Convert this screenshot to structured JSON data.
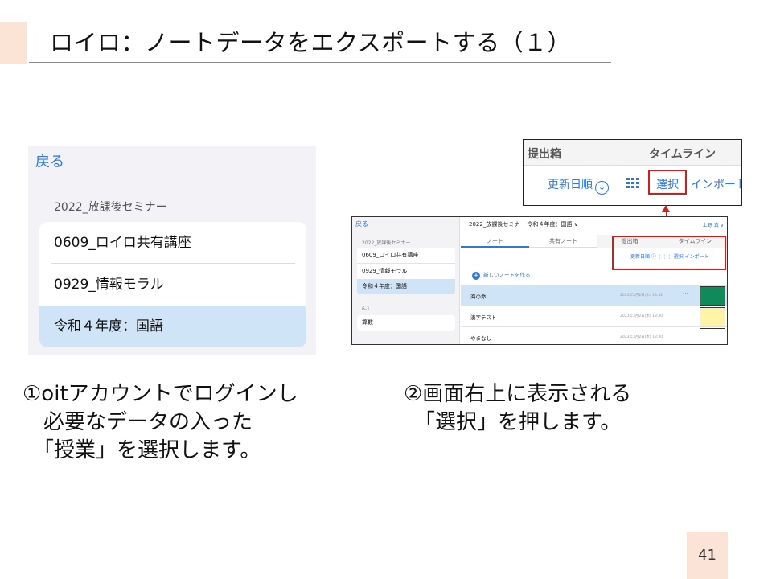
{
  "slide": {
    "title": "ロイロ：ノートデータをエクスポートする（１）",
    "page_number": "41",
    "accent_color": "#fbe3d5"
  },
  "screenshot1": {
    "back": "戻る",
    "section": "2022_放課後セミナー",
    "items": [
      "0609_ロイロ共有講座",
      "0929_情報モラル",
      "令和４年度：国語"
    ],
    "selected_index": 2
  },
  "zoom": {
    "tab_submit": "提出箱",
    "tab_timeline": "タイムライン",
    "sort": "更新日順",
    "sort_icon": "down-arrow-circle-icon",
    "grid_icon": "grid-icon",
    "select": "選択",
    "import": "インポート"
  },
  "screenshot2": {
    "back": "戻る",
    "section": "2022_放課後セミナー",
    "items": [
      "0609_ロイロ共有講座",
      "0929_情報モラル",
      "令和４年度：国語"
    ],
    "section2": "6-1",
    "item2": "算数",
    "main_title": "2022_放課後セミナー 令和４年度：国語 ∨",
    "user": "上野 真 ∨",
    "tabs": [
      "ノート",
      "共有ノート",
      "提出箱",
      "タイムライン"
    ],
    "tools": "更新日順 ⓘ  ⋮⋮⋮  選択  インポート",
    "new_note": "新しいノートを作る",
    "rows": [
      {
        "name": "海の命",
        "date": "2023年3月2日(木) 13:32",
        "swatch": "#0f8a5a"
      },
      {
        "name": "漢字テスト",
        "date": "2023年3月2日(木) 13:30",
        "swatch": "#fff3a8"
      },
      {
        "name": "やまなし",
        "date": "2023年3月2日(木) 13:30",
        "swatch": "#ffffff"
      }
    ],
    "more": "···"
  },
  "captions": {
    "step1": "①oitアカウントでログインし\n　必要なデータの入った\n　「授業」を選択します。",
    "step2": "②画面右上に表示される\n　「選択」を押します。"
  },
  "colors": {
    "link_blue": "#2e78d8",
    "highlight_red": "#cc1f1f",
    "selected_row": "#d0e4f7"
  }
}
